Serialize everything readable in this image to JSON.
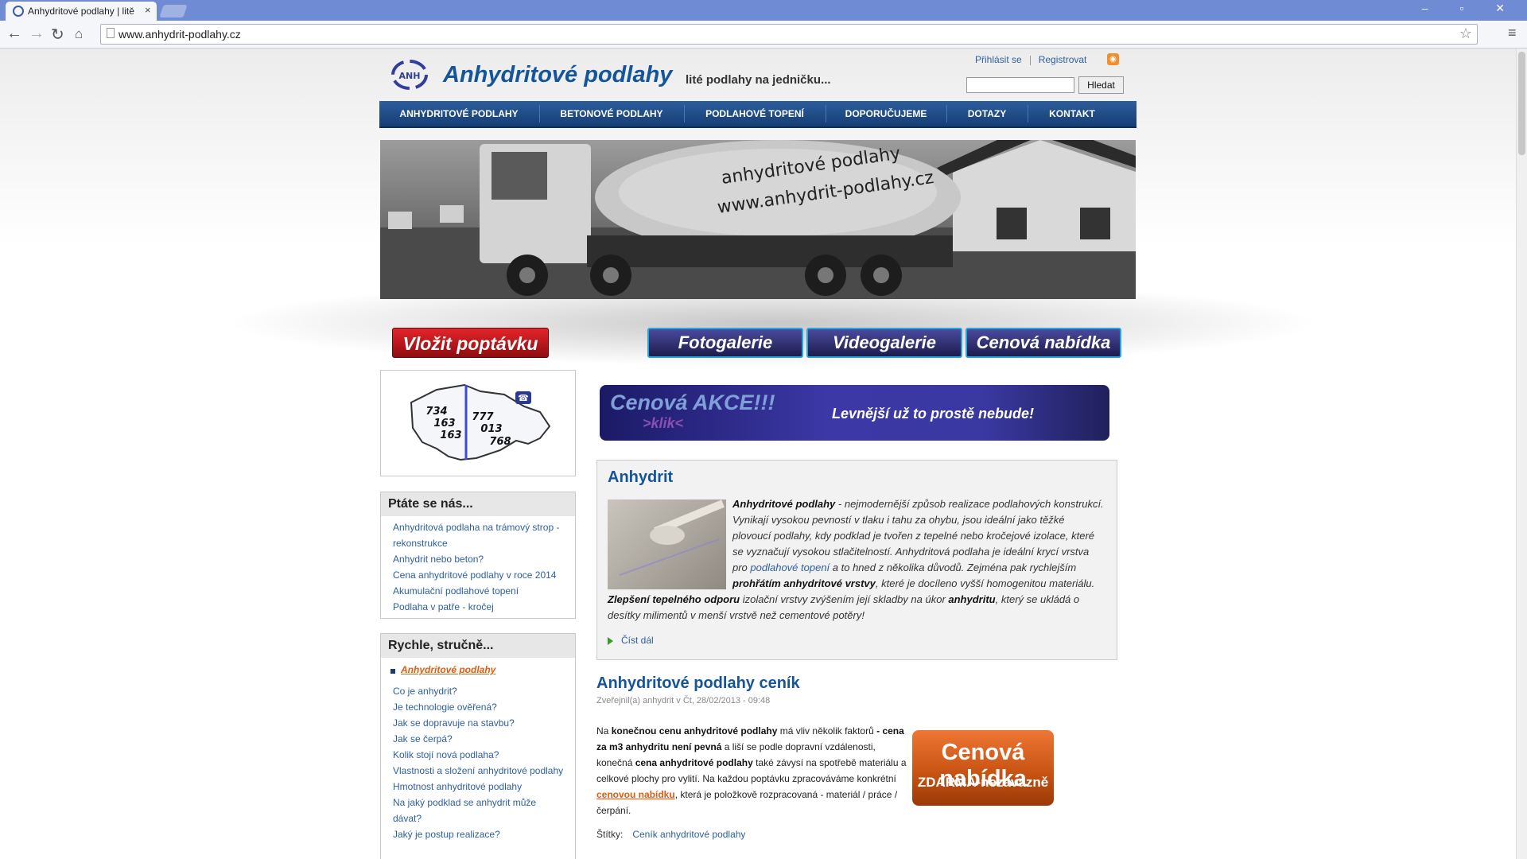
{
  "browser": {
    "tab_title": "Anhydritové podlahy | litě",
    "tab_close": "×",
    "url": "www.anhydrit-podlahy.cz",
    "window_controls": "– ▫ ✕"
  },
  "header": {
    "site_title": "Anhydritové podlahy",
    "slogan": "lité podlahy na jedničku...",
    "login": "Přihlásit se",
    "register": "Registrovat",
    "search_button": "Hledat",
    "search_value": ""
  },
  "nav": [
    "ANHYDRITOVÉ PODLAHY",
    "BETONOVÉ PODLAHY",
    "PODLAHOVÉ TOPENÍ",
    "DOPORUČUJEME",
    "DOTAZY",
    "KONTAKT"
  ],
  "hero": {
    "line1": "anhydritové podlahy",
    "line2": "www.anhydrit-podlahy.cz"
  },
  "buttons": {
    "vlozit": "Vložit poptávku",
    "fotogalerie": "Fotogalerie",
    "videogalerie": "Videogalerie",
    "cenova": "Cenová nabídka"
  },
  "phone_map": {
    "left": [
      "734",
      "163",
      "163"
    ],
    "right": [
      "777",
      "013",
      "768"
    ]
  },
  "sidebar": {
    "ptate_title": "Ptáte se nás...",
    "ptate_links": [
      "Anhydritová podlaha na trámový strop - rekonstrukce",
      "Anhydrit nebo beton?",
      "Cena anhydritové podlahy v roce 2014",
      "Akumulační podlahové topení",
      "Podlaha v patře - kročej"
    ],
    "rychle_title": "Rychle, stručně...",
    "rychle_active": "Anhydritové podlahy",
    "rychle_links": [
      "Co je anhydrit?",
      "Je technologie ověřená?",
      "Jak se dopravuje na stavbu?",
      "Jak se čerpá?",
      "Kolik stojí nová podlaha?",
      "Vlastnosti a složení anhydritové podlahy",
      "Hmotnost anhydritové podlahy",
      "Na jaký podklad se anhydrit může dávat?",
      "Jaký je postup realizace?"
    ]
  },
  "banner_akce": {
    "main": "Cenová AKCE!!!",
    "klik": ">klik<",
    "right": "Levnější už to prostě nebude!"
  },
  "article": {
    "title": "Anhydrit",
    "p_b1": "Anhydritové podlahy",
    "p_t1": " - nejmodernější způsob realizace podlahových konstrukcí. Vynikají vysokou pevností v tlaku i tahu za ohybu, jsou ideální jako těžké plovoucí podlahy, kdy podklad je tvořen z tepelné nebo kročejové izolace, které se vyznačují vysokou stlačitelností. Anhydritová podlaha je ideální krycí vrstva pro ",
    "p_link": "podlahové topení",
    "p_t2": " a to hned z několika důvodů. Zejména pak rychlejším ",
    "p_b2": "prohřátím anhydritové vrstvy",
    "p_t3": ", které je docíleno vyšší homogenitou materiálu. ",
    "p_b3": "Zlepšení tepelného odporu",
    "p_t4": " izolační vrstvy zvýšením její skladby na úkor ",
    "p_b4": "anhydritu",
    "p_t5": ", který se ukládá o desítky milimentů v menší vrstvě než cementové potěry!",
    "read_more": "Číst dál"
  },
  "post": {
    "title": "Anhydritové podlahy ceník",
    "meta": "Zveřejnil(a) anhydrit v Čt, 28/02/2013 - 09:48",
    "t1": "Na ",
    "b1": "konečnou cenu anhydritové podlahy",
    "t2": " má vliv několik faktorů ",
    "b2": "- cena za m3 anhydritu není pevná",
    "t3": " a liší se podle dopravní vzdálenosti, konečná ",
    "b3": "cena anhydritové podlahy",
    "t4": " také závysí na spotřebě materiálu a celkové plochy pro vylití. Na každou poptávku zpracováváme konkrétní ",
    "link": "cenovou nabídku",
    "t5": ", která je položkově rozpracovaná - materiál / práce / čerpání.",
    "tags_label": "Štítky:",
    "tags_link": "Ceník anhydritové podlahy"
  },
  "cenova_btn": {
    "l1": "Cenová nabídka",
    "l2": "ZDARMA-nezávazně"
  }
}
